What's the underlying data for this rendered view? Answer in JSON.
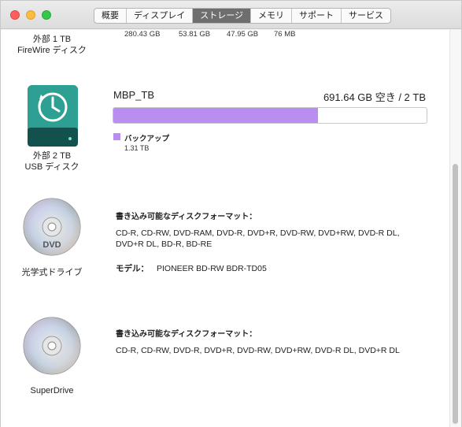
{
  "tabs": [
    "概要",
    "ディスプレイ",
    "ストレージ",
    "メモリ",
    "サポート",
    "サービス"
  ],
  "active_tab": 2,
  "devices": {
    "external1": {
      "label_line1": "外部 1 TB",
      "label_line2": "FireWire ディスク",
      "stats": [
        "280.43 GB",
        "53.81 GB",
        "47.95 GB",
        "76 MB"
      ]
    },
    "external2": {
      "label_line1": "外部 2 TB",
      "label_line2": "USB ディスク",
      "volume_name": "MBP_TB",
      "capacity_text": "691.64 GB 空き / 2 TB",
      "used_fraction": 0.654,
      "bar_color": "#b98ef0",
      "legend_label": "バックアップ",
      "legend_size": "1.31 TB"
    },
    "optical": {
      "label": "光学式ドライブ",
      "formats_title": "書き込み可能なディスクフォーマット：",
      "formats_line1": "CD-R, CD-RW, DVD-RAM, DVD-R, DVD+R, DVD-RW, DVD+RW, DVD-R DL,",
      "formats_line2": "DVD+R DL, BD-R, BD-RE",
      "model_label": "モデル：",
      "model_value": "PIONEER BD-RW BDR-TD05"
    },
    "superdrive": {
      "label": "SuperDrive",
      "formats_title": "書き込み可能なディスクフォーマット：",
      "formats_line1": "CD-R, CD-RW, DVD-R, DVD+R, DVD-RW, DVD+RW, DVD-R DL, DVD+R DL"
    }
  },
  "icons": {
    "time_machine_drive": "time-machine-drive-icon",
    "dvd_disc": "dvd-disc-icon",
    "cd_disc": "cd-disc-icon"
  }
}
